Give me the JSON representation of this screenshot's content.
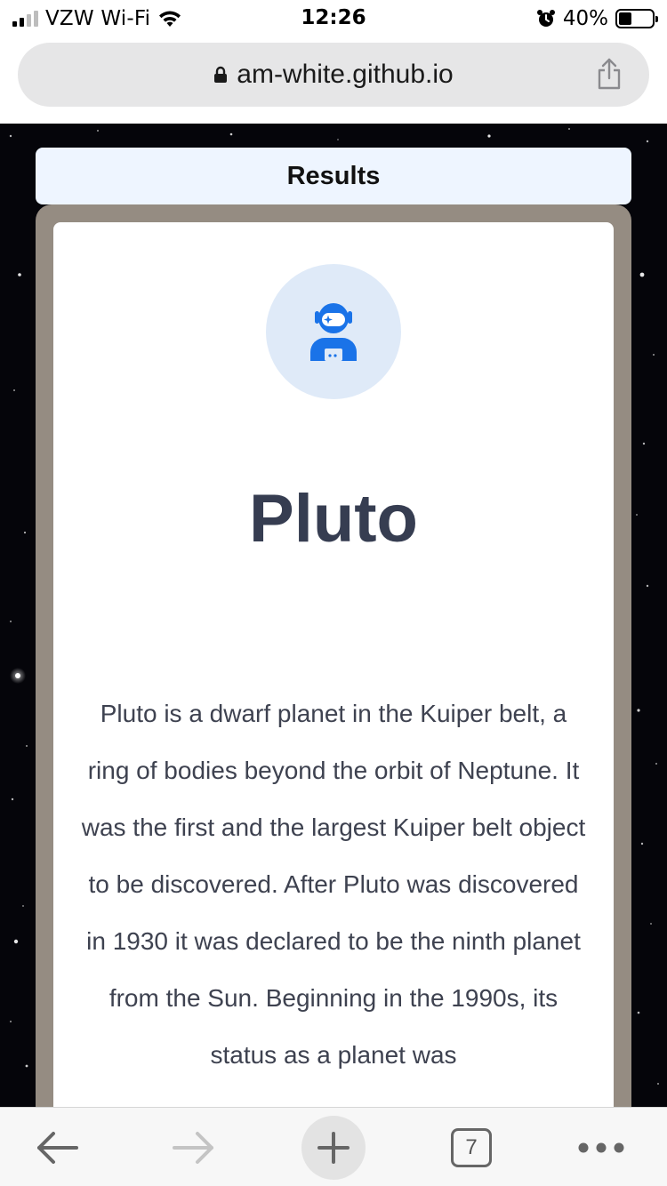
{
  "status_bar": {
    "carrier": "VZW Wi-Fi",
    "time": "12:26",
    "battery_percent": "40%",
    "battery_level": 0.4,
    "signal_bars_filled": 2,
    "signal_bars_total": 4
  },
  "url_bar": {
    "url": "am-white.github.io"
  },
  "page": {
    "results_label": "Results",
    "planet_name": "Pluto",
    "description": "Pluto is a dwarf planet in the Kuiper belt, a ring of bodies beyond the orbit of Neptune. It was the first and the largest Kuiper belt object to be discovered. After Pluto was discovered in 1930 it was declared to be the ninth planet from the Sun. Beginning in the 1990s, its status as a planet was",
    "avatar_icon": "astronaut-icon",
    "colors": {
      "card_background": "#ffffff",
      "frame": "#958c82",
      "results_bar": "#eef5ff",
      "avatar_bg": "#dfeaf8",
      "avatar_icon": "#1a73e8",
      "title": "#363d51"
    }
  },
  "toolbar": {
    "tab_count": "7",
    "icons": [
      "back-arrow-icon",
      "forward-arrow-icon",
      "plus-icon",
      "tabs-icon",
      "more-icon"
    ]
  }
}
